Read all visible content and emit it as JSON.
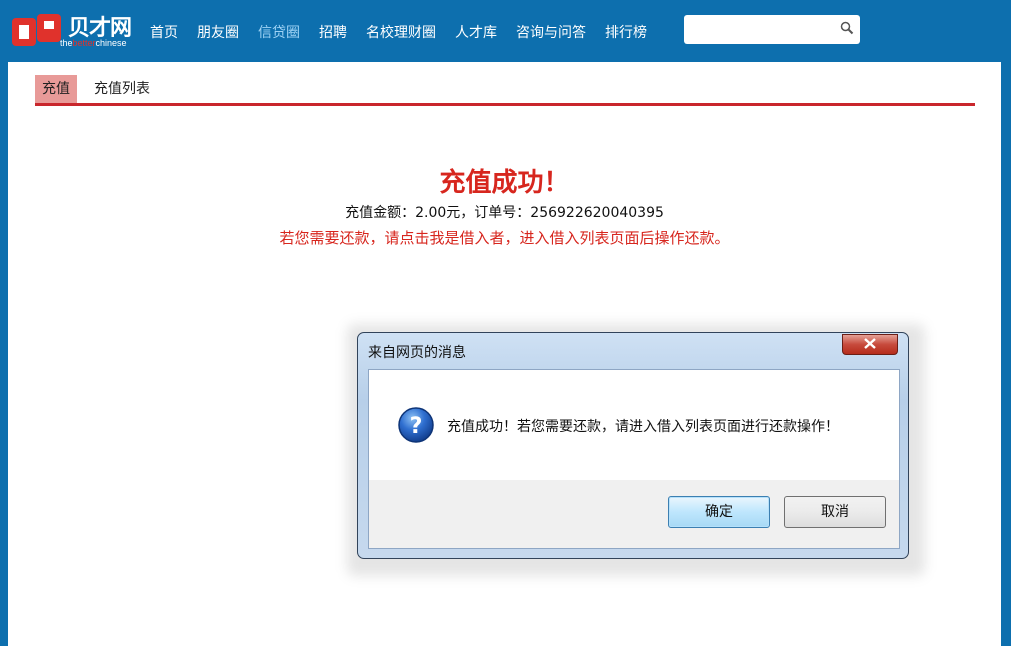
{
  "header": {
    "logo_text": "贝才网",
    "logo_sub_left": "the",
    "logo_sub_mid": "better",
    "logo_sub_right": "chinese",
    "nav": [
      {
        "label": "首页"
      },
      {
        "label": "朋友圈"
      },
      {
        "label": "信贷圈"
      },
      {
        "label": "招聘"
      },
      {
        "label": "名校理财圈"
      },
      {
        "label": "人才库"
      },
      {
        "label": "咨询与问答"
      },
      {
        "label": "排行榜"
      }
    ],
    "active_nav": "信贷圈",
    "search": {
      "value": "",
      "placeholder": ""
    }
  },
  "tabs": {
    "recharge": "充值",
    "recharge_list": "充值列表"
  },
  "result": {
    "title": "充值成功！",
    "info": "充值金额：2.00元，订单号：256922620040395",
    "hint": "若您需要还款，请点击我是借入者，进入借入列表页面后操作还款。"
  },
  "dialog": {
    "title": "来自网页的消息",
    "message": "充值成功！若您需要还款，请进入借入列表页面进行还款操作！",
    "ok_label": "确定",
    "cancel_label": "取消"
  },
  "colors": {
    "brand_blue": "#0d6fae",
    "accent_red": "#d7261e",
    "tab_active": "#e89a98"
  }
}
